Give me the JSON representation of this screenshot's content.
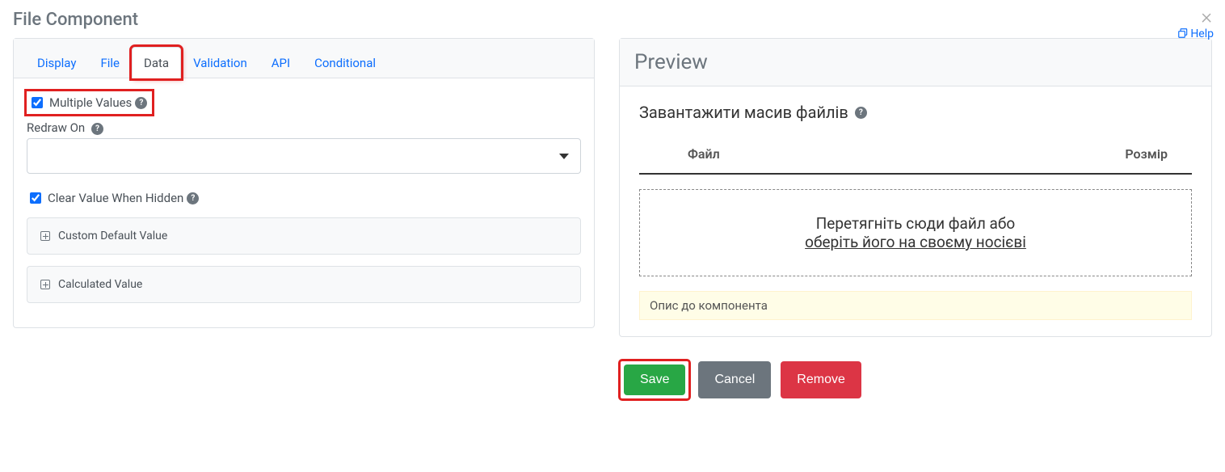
{
  "modal": {
    "title": "File Component",
    "help": "Help"
  },
  "tabs": {
    "display": "Display",
    "file": "File",
    "data": "Data",
    "validation": "Validation",
    "api": "API",
    "conditional": "Conditional"
  },
  "form": {
    "multiple_values": "Multiple Values",
    "redraw_on": "Redraw On",
    "clear_when_hidden": "Clear Value When Hidden",
    "custom_default": "Custom Default Value",
    "calculated_value": "Calculated Value"
  },
  "preview": {
    "title": "Preview",
    "label": "Завантажити масив файлів",
    "col_file": "Файл",
    "col_size": "Розмір",
    "drop_text": "Перетягніть сюди файл або",
    "browse_text": "оберіть його на своєму носієві",
    "description": "Опис до компонента"
  },
  "buttons": {
    "save": "Save",
    "cancel": "Cancel",
    "remove": "Remove"
  }
}
